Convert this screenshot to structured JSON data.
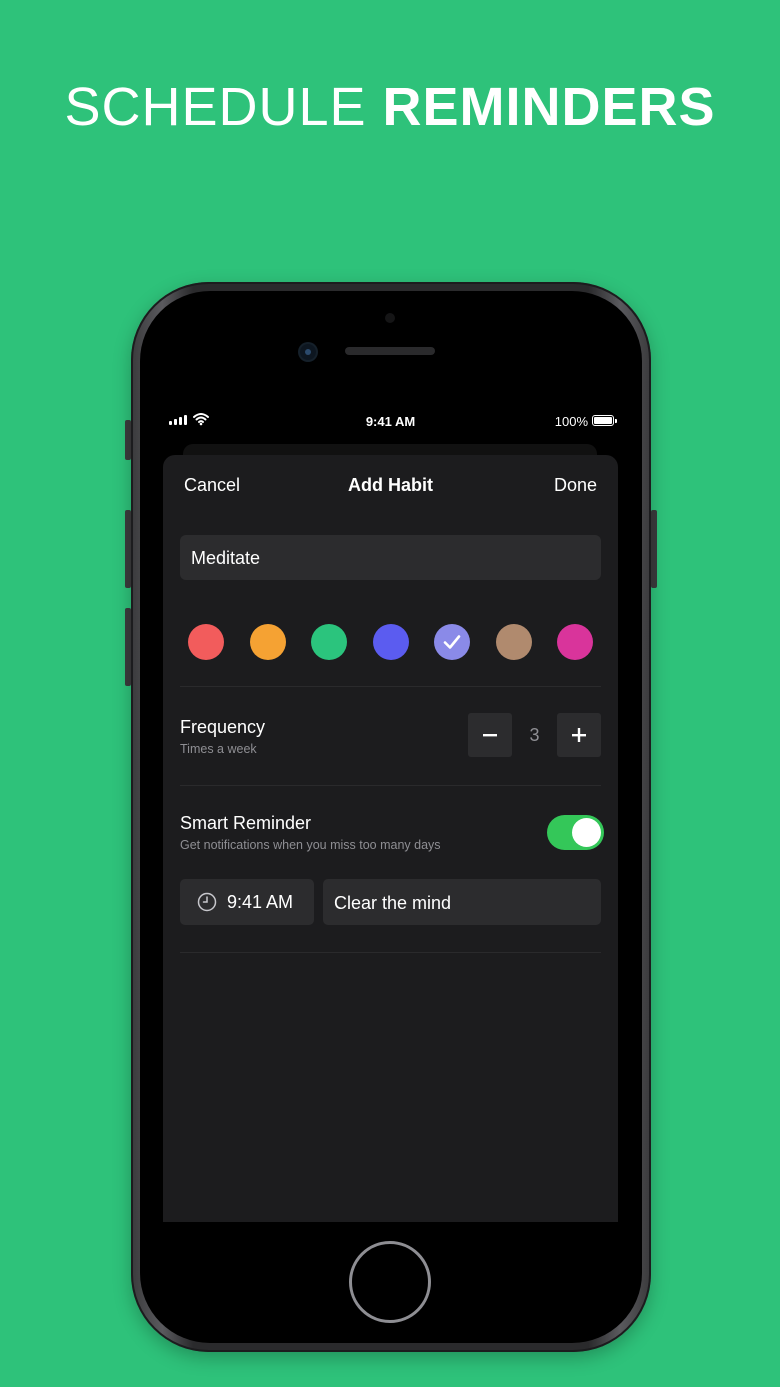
{
  "headline": {
    "light": "SCHEDULE",
    "bold": "REMINDERS"
  },
  "status_bar": {
    "time": "9:41 AM",
    "battery": "100%"
  },
  "nav": {
    "cancel": "Cancel",
    "title": "Add Habit",
    "done": "Done"
  },
  "habit_name": "Meditate",
  "colors": [
    {
      "name": "red",
      "hex": "#f25c5c",
      "selected": false
    },
    {
      "name": "orange",
      "hex": "#f5a233",
      "selected": false
    },
    {
      "name": "green",
      "hex": "#2bc47d",
      "selected": false
    },
    {
      "name": "blue",
      "hex": "#5b5cf0",
      "selected": false
    },
    {
      "name": "lavender",
      "hex": "#8a8ae8",
      "selected": true
    },
    {
      "name": "brown",
      "hex": "#b08a6e",
      "selected": false
    },
    {
      "name": "pink",
      "hex": "#d9349b",
      "selected": false
    }
  ],
  "frequency": {
    "title": "Frequency",
    "subtitle": "Times a week",
    "value": "3"
  },
  "smart_reminder": {
    "title": "Smart Reminder",
    "subtitle": "Get notifications when you miss too many days",
    "enabled": true
  },
  "reminder": {
    "time": "9:41 AM",
    "message": "Clear the mind"
  }
}
